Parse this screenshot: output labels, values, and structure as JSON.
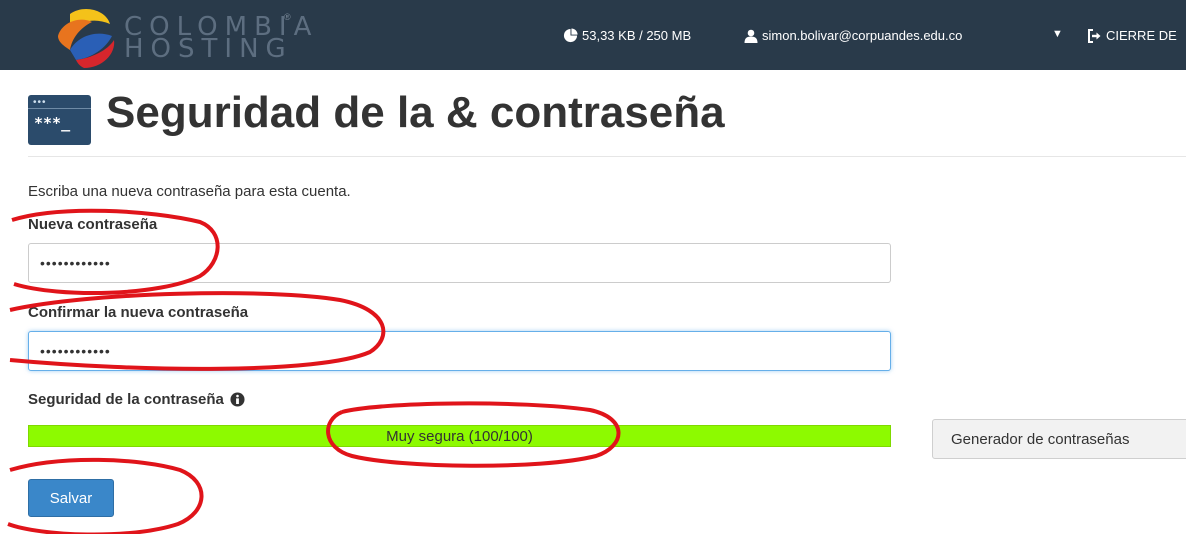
{
  "topbar": {
    "logo_line1": "COLOMBIA",
    "logo_line2": "HOSTING",
    "logo_mark": "®",
    "disk_usage": "53,33 KB / 250 MB",
    "disk_icon": "pie-chart-icon",
    "user_email": "simon.bolivar@corpuandes.edu.co",
    "user_icon": "user-icon",
    "logout_label": "CIERRE DE",
    "logout_icon": "logout-icon",
    "bg_color": "#293a4a"
  },
  "header": {
    "icon_text": "***_",
    "title": "Seguridad de la & contraseña"
  },
  "form": {
    "intro": "Escriba una nueva contraseña para esta cuenta.",
    "new_password_label": "Nueva contraseña",
    "new_password_value": "••••••••••••",
    "confirm_password_label": "Confirmar la nueva contraseña",
    "confirm_password_value": "••••••••••••",
    "strength_label": "Seguridad de la contraseña",
    "strength_text": "Muy segura (100/100)",
    "strength_value": 100,
    "strength_color": "#8dfa00",
    "generator_button": "Generador de contraseñas",
    "save_button": "Salvar",
    "save_color": "#3a87c9"
  }
}
